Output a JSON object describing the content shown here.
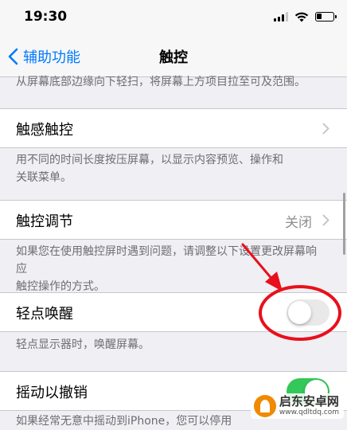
{
  "status": {
    "time": "19:30",
    "battery_level": 0.3
  },
  "nav": {
    "back_label": "辅助功能",
    "title": "触控"
  },
  "sections": {
    "top_footer": "从屏幕底部边缘向下轻扫，将屏幕上方项目拉至可及范围。",
    "haptic_touch": {
      "label": "触感触控",
      "footer_line1": "用不同的时间长度按压屏幕，以显示内容预览、操作和",
      "footer_line2": "关联菜单。"
    },
    "touch_accommodations": {
      "label": "触控调节",
      "value": "关闭",
      "footer_line1": "如果您在使用触控屏时遇到问题，请调整以下设置更改屏幕响应",
      "footer_line2": "触控操作的方式。"
    },
    "tap_to_wake": {
      "label": "轻点唤醒",
      "enabled": false,
      "footer": "轻点显示器时，唤醒屏幕。"
    },
    "shake_to_undo": {
      "label": "摇动以撤销",
      "enabled": true,
      "footer_partial": "如果经常无意中摇动到iPhone，您可以停用"
    }
  },
  "colors": {
    "accent": "#007aff",
    "annotation": "#e8101c",
    "toggle_on": "#34c759"
  },
  "watermark": {
    "title": "启东安卓网",
    "url": "www.qdltdq.com"
  }
}
